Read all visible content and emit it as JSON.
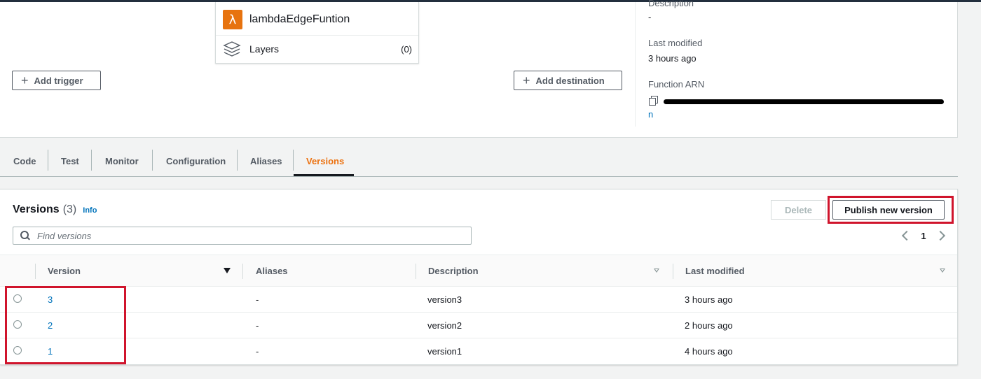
{
  "overview": {
    "function_name": "lambdaEdgeFuntion",
    "layers_label": "Layers",
    "layers_count": "(0)",
    "add_trigger_label": "Add trigger",
    "add_destination_label": "Add destination",
    "description_label": "Description",
    "description_value": "-",
    "last_modified_label": "Last modified",
    "last_modified_value": "3 hours ago",
    "function_arn_label": "Function ARN",
    "function_arn_tail": "n"
  },
  "tabs": [
    "Code",
    "Test",
    "Monitor",
    "Configuration",
    "Aliases",
    "Versions"
  ],
  "active_tab": "Versions",
  "versions_panel": {
    "title": "Versions",
    "count": "(3)",
    "info_label": "Info",
    "delete_label": "Delete",
    "publish_label": "Publish new version",
    "search_placeholder": "Find versions",
    "page": "1",
    "columns": {
      "version": "Version",
      "aliases": "Aliases",
      "description": "Description",
      "last_modified": "Last modified"
    },
    "rows": [
      {
        "version": "3",
        "aliases": "-",
        "description": "version3",
        "last_modified": "3 hours ago"
      },
      {
        "version": "2",
        "aliases": "-",
        "description": "version2",
        "last_modified": "2 hours ago"
      },
      {
        "version": "1",
        "aliases": "-",
        "description": "version1",
        "last_modified": "4 hours ago"
      }
    ]
  },
  "colors": {
    "accent_orange": "#ec7211",
    "link_blue": "#0073bb",
    "highlight_red": "#d0142c",
    "lambda_orange": "#e7730f"
  }
}
